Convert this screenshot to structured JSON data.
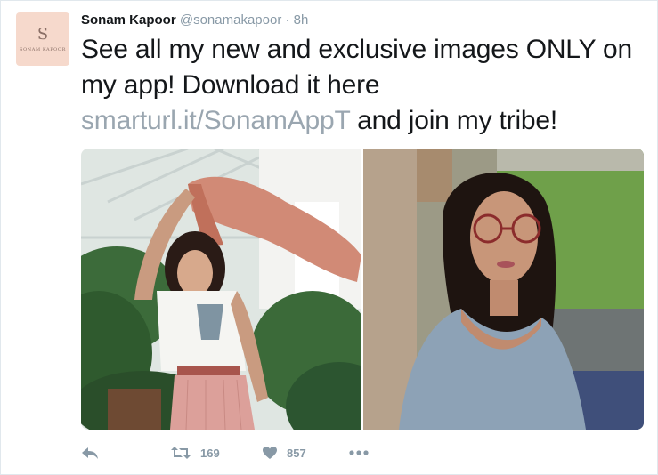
{
  "author": {
    "avatar_monogram": "S",
    "avatar_brand": "SONAM KAPOOR",
    "name": "Sonam Kapoor",
    "handle": "@sonamakapoor",
    "separator": "·",
    "time": "8h"
  },
  "tweet": {
    "text_before": "See all my new and exclusive images ONLY on my app! Download it here ",
    "link": "smarturl.it/SonamAppT",
    "text_after": " and join my tribe!"
  },
  "media": {
    "photos": [
      "photo-left",
      "photo-right"
    ]
  },
  "actions": {
    "reply_icon": "reply-icon",
    "retweet_icon": "retweet-icon",
    "retweet_count": "169",
    "like_icon": "heart-icon",
    "like_count": "857",
    "more_icon": "more-icon"
  },
  "colors": {
    "text": "#14171a",
    "muted": "#8899a6",
    "link": "#9aa6b0",
    "avatar_bg": "#f6d9cc"
  }
}
